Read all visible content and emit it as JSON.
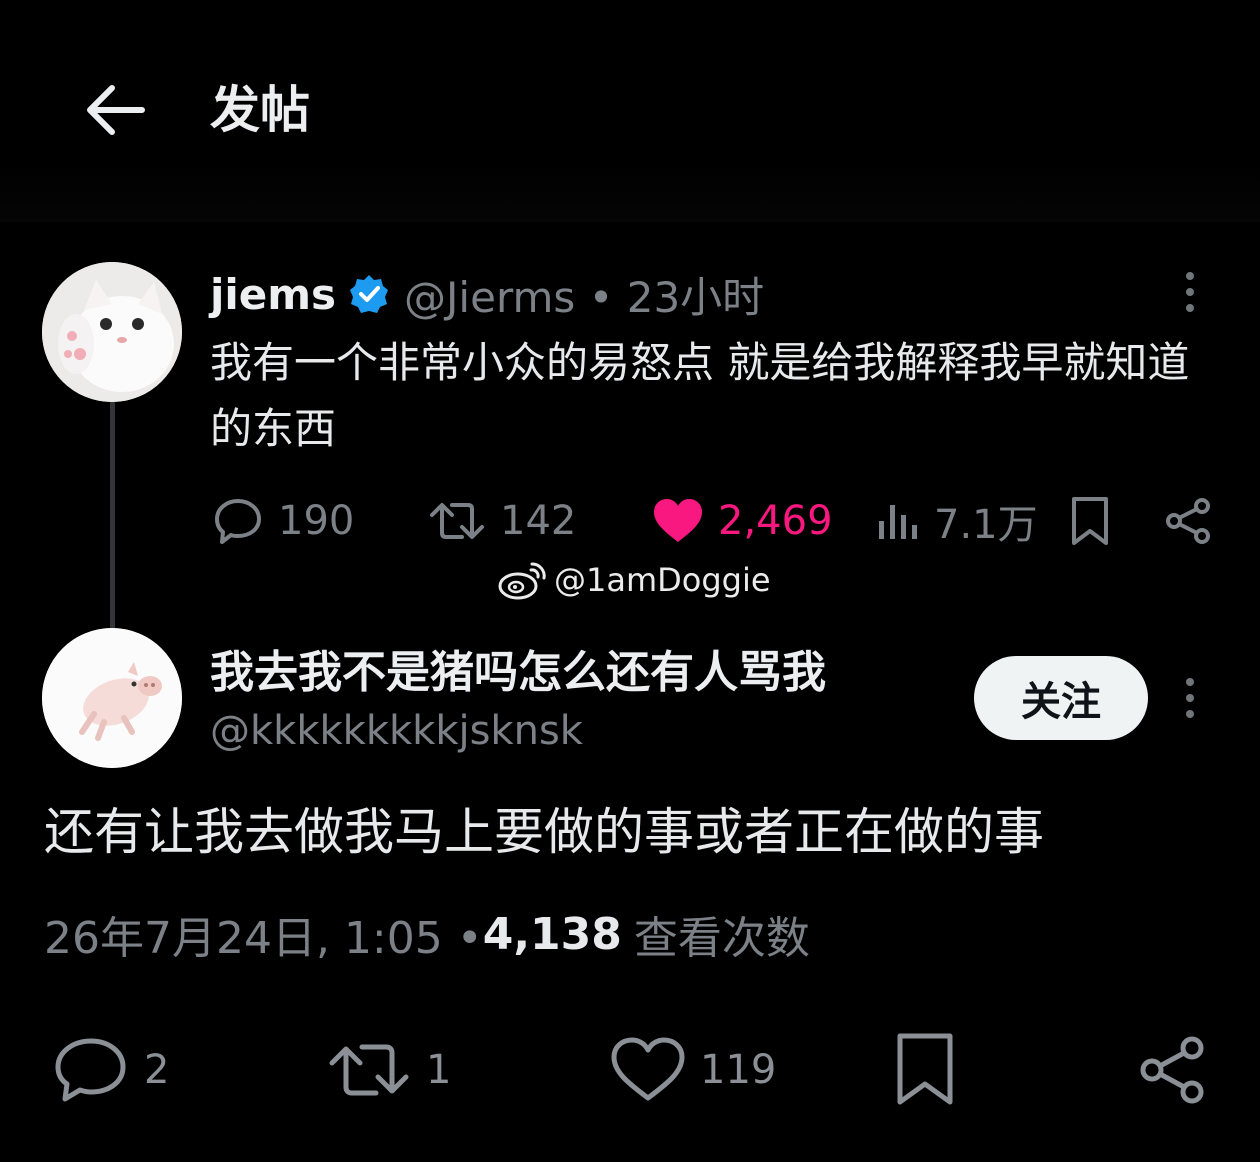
{
  "header": {
    "title": "发帖",
    "back_icon": "arrow-left-icon"
  },
  "parent_tweet": {
    "display_name": "jiems",
    "verified": true,
    "handle_time": "@Jierms • 23小时",
    "text": "我有一个非常小众的易怒点 就是给我解释我早就知道的东西",
    "replies": "190",
    "reposts": "142",
    "likes": "2,469",
    "views": "7.1万",
    "liked": true
  },
  "watermark": {
    "icon": "weibo-icon",
    "text": "@1amDoggie"
  },
  "reply_tweet": {
    "display_name": "我去我不是猪吗怎么还有人骂我",
    "handle": "@kkkkkkkkkjsknsk",
    "follow_label": "关注",
    "text": "还有让我去做我马上要做的事或者正在做的事",
    "timestamp": "26年7月24日, 1:05 • ",
    "views_count": "4,138",
    "views_label": "查看次数",
    "replies": "2",
    "reposts": "1",
    "likes": "119"
  },
  "colors": {
    "background": "#000000",
    "muted": "#7c8187",
    "like": "#f91880",
    "verified": "#1d9bf0",
    "follow_button_bg": "#eff3f4"
  }
}
